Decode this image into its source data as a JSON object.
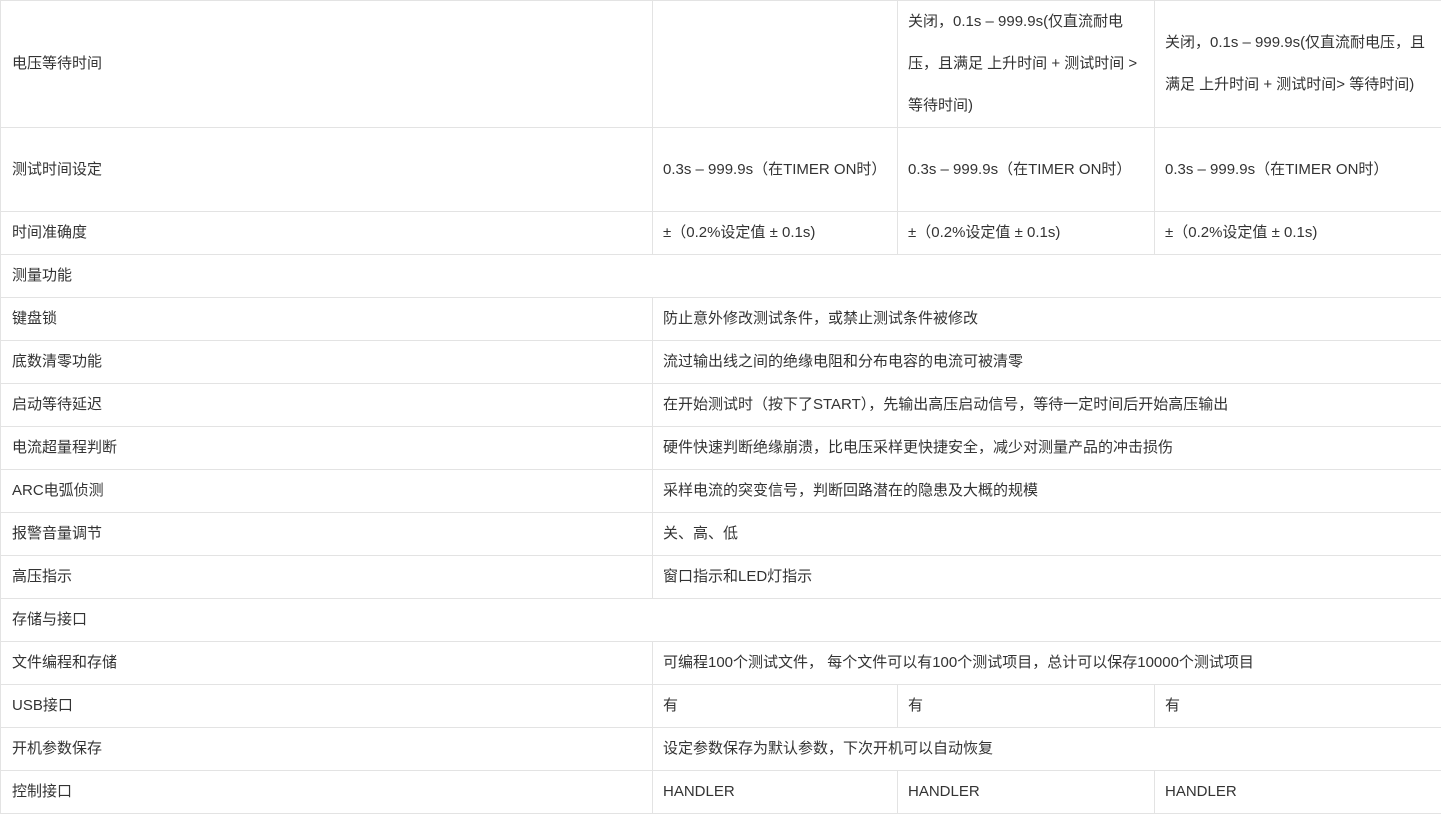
{
  "rows": [
    {
      "label": "电压等待时间",
      "cells": [
        "",
        "关闭，0.1s – 999.9s(仅直流耐电压，且满足 上升时间 + 测试时间 > 等待时间)",
        "关闭，0.1s – 999.9s(仅直流耐电压，且满足 上升时间 + 测试时间> 等待时间)"
      ]
    },
    {
      "label": "测试时间设定",
      "cells": [
        "0.3s – 999.9s（在TIMER ON时）",
        "0.3s – 999.9s（在TIMER ON时）",
        "0.3s – 999.9s（在TIMER ON时）"
      ]
    },
    {
      "label": "时间准确度",
      "cells": [
        "±（0.2%设定值 ± 0.1s)",
        "±（0.2%设定值 ± 0.1s)",
        "±（0.2%设定值 ± 0.1s)"
      ]
    },
    {
      "label": "测量功能",
      "section": true
    },
    {
      "label": "键盘锁",
      "merged": "防止意外修改测试条件，或禁止测试条件被修改"
    },
    {
      "label": "底数清零功能",
      "merged": "流过输出线之间的绝缘电阻和分布电容的电流可被清零"
    },
    {
      "label": "启动等待延迟",
      "merged": "在开始测试时（按下了START），先输出高压启动信号，等待一定时间后开始高压输出"
    },
    {
      "label": "电流超量程判断",
      "merged": "硬件快速判断绝缘崩溃，比电压采样更快捷安全，减少对测量产品的冲击损伤"
    },
    {
      "label": "ARC电弧侦测",
      "merged": "采样电流的突变信号，判断回路潜在的隐患及大概的规模"
    },
    {
      "label": "报警音量调节",
      "merged": "关、高、低"
    },
    {
      "label": "高压指示",
      "merged": "窗口指示和LED灯指示"
    },
    {
      "label": "存储与接口",
      "section": true
    },
    {
      "label": "文件编程和存储",
      "merged": "可编程100个测试文件， 每个文件可以有100个测试项目，总计可以保存10000个测试项目"
    },
    {
      "label": "USB接口",
      "cells": [
        "有",
        "有",
        "有"
      ]
    },
    {
      "label": "开机参数保存",
      "merged": "设定参数保存为默认参数，下次开机可以自动恢复"
    },
    {
      "label": "控制接口",
      "cells": [
        "HANDLER",
        "HANDLER",
        "HANDLER"
      ]
    }
  ]
}
